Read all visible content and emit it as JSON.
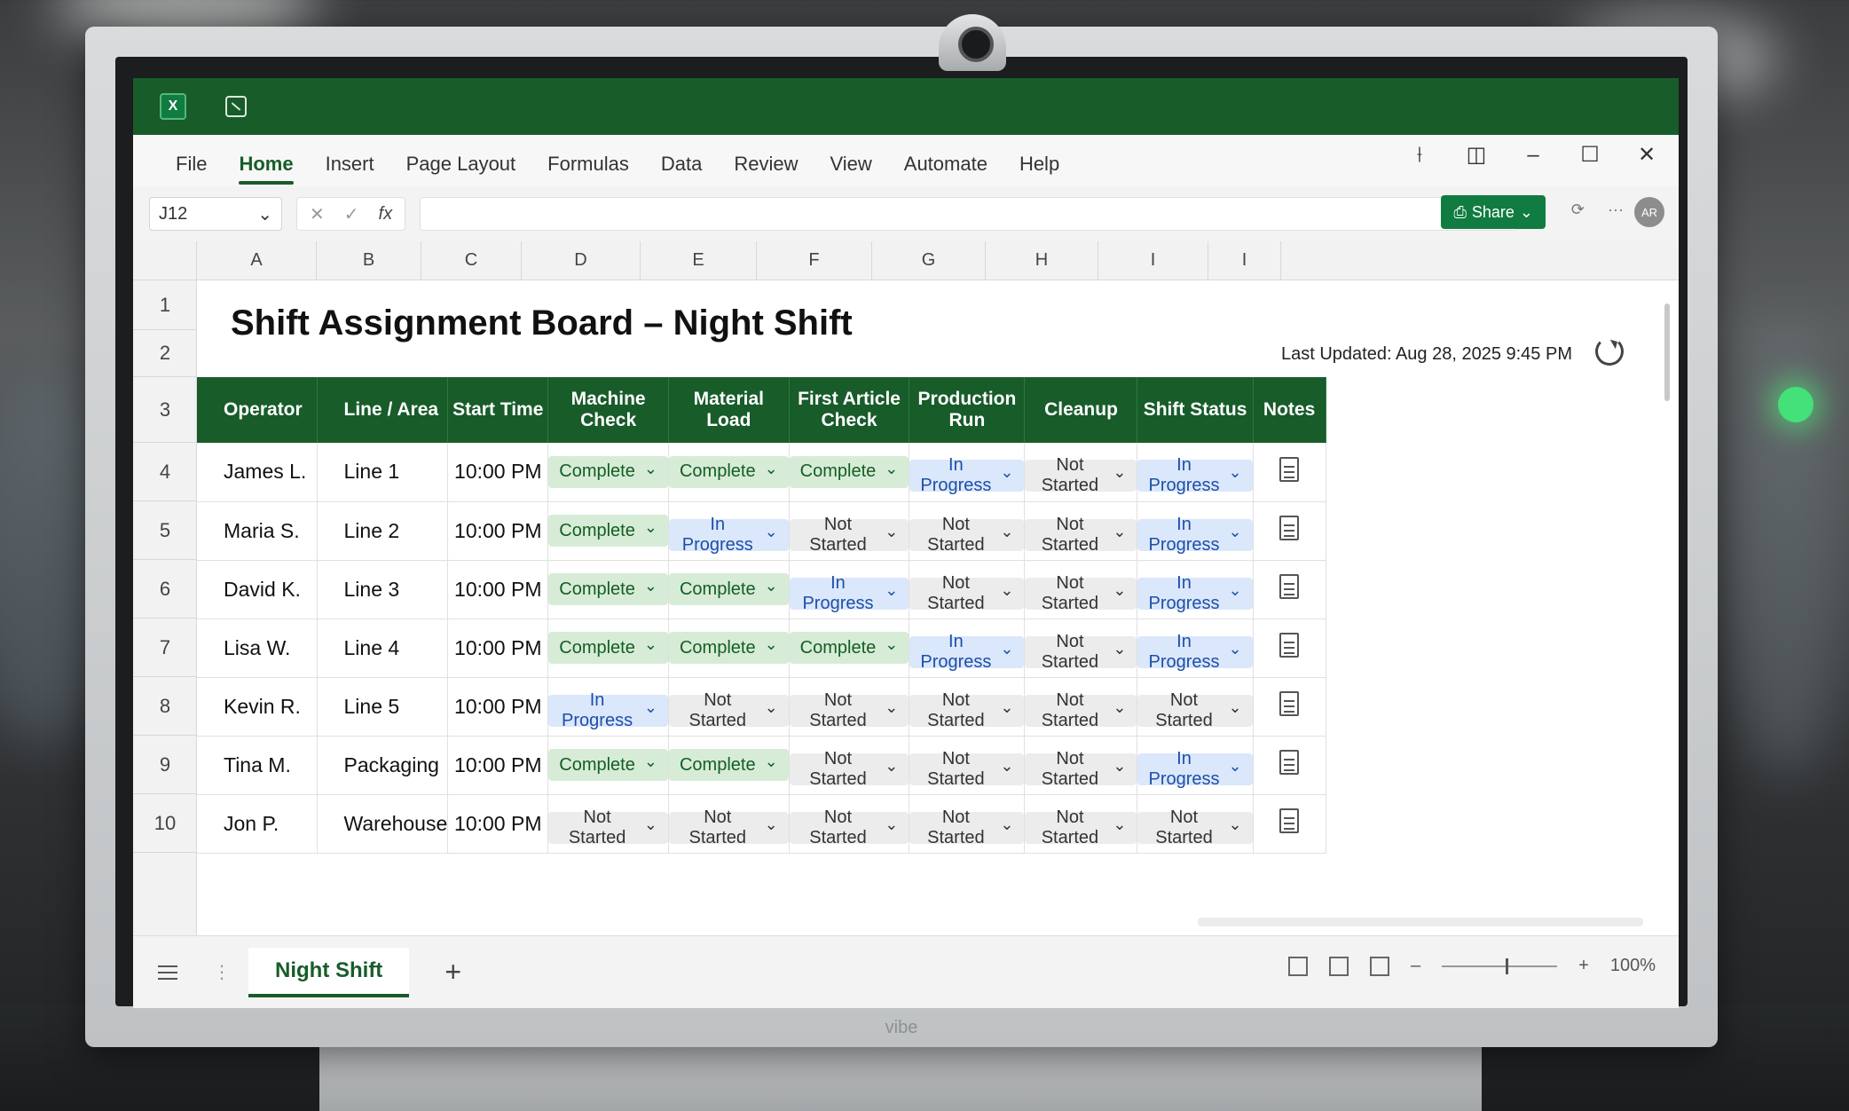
{
  "app": {
    "name_box": "J12",
    "ribbon_tabs": [
      "File",
      "Home",
      "Insert",
      "Page Layout",
      "Formulas",
      "Data",
      "Review",
      "View",
      "Automate",
      "Help"
    ],
    "active_tab": "Home",
    "share_label": "Share",
    "avatar_initials": "AR",
    "fx_label": "fx"
  },
  "columns": [
    "A",
    "B",
    "C",
    "D",
    "E",
    "F",
    "G",
    "H",
    "I",
    "I"
  ],
  "rows": [
    "1",
    "2",
    "3",
    "4",
    "5",
    "6",
    "7",
    "8",
    "9",
    "10"
  ],
  "sheet": {
    "title": "Shift Assignment Board – Night Shift",
    "last_updated": "Last Updated: Aug 28, 2025 9:45 PM",
    "headers": [
      "Operator",
      "Line / Area",
      "Start Time",
      "Machine Check",
      "Material Load",
      "First Article Check",
      "Production Run",
      "Cleanup",
      "Shift Status",
      "Notes"
    ],
    "records": [
      {
        "operator": "James L.",
        "line": "Line 1",
        "start": "10:00 PM",
        "statuses": [
          "Complete",
          "Complete",
          "Complete",
          "In Progress",
          "Not Started",
          "In Progress"
        ]
      },
      {
        "operator": "Maria S.",
        "line": "Line 2",
        "start": "10:00 PM",
        "statuses": [
          "Complete",
          "In Progress",
          "Not Started",
          "Not Started",
          "Not Started",
          "In Progress"
        ]
      },
      {
        "operator": "David K.",
        "line": "Line 3",
        "start": "10:00 PM",
        "statuses": [
          "Complete",
          "Complete",
          "In Progress",
          "Not Started",
          "Not Started",
          "In Progress"
        ]
      },
      {
        "operator": "Lisa W.",
        "line": "Line 4",
        "start": "10:00 PM",
        "statuses": [
          "Complete",
          "Complete",
          "Complete",
          "In Progress",
          "Not Started",
          "In Progress"
        ]
      },
      {
        "operator": "Kevin R.",
        "line": "Line 5",
        "start": "10:00 PM",
        "statuses": [
          "In Progress",
          "Not Started",
          "Not Started",
          "Not Started",
          "Not Started",
          "Not Started"
        ]
      },
      {
        "operator": "Tina M.",
        "line": "Packaging",
        "start": "10:00 PM",
        "statuses": [
          "Complete",
          "Complete",
          "Not Started",
          "Not Started",
          "Not Started",
          "In Progress"
        ]
      },
      {
        "operator": "Jon P.",
        "line": "Warehouse",
        "start": "10:00 PM",
        "statuses": [
          "Not Started",
          "Not Started",
          "Not Started",
          "Not Started",
          "Not Started",
          "Not Started"
        ]
      }
    ]
  },
  "bottom": {
    "sheet_tab": "Night Shift",
    "add_sheet": "+",
    "zoom": "100%"
  },
  "monitor_brand": "vibe",
  "colors": {
    "excel_green": "#185c2a",
    "complete_bg": "#d6ecd7",
    "in_progress_bg": "#dbe7fb",
    "not_started_bg": "#ececec"
  }
}
